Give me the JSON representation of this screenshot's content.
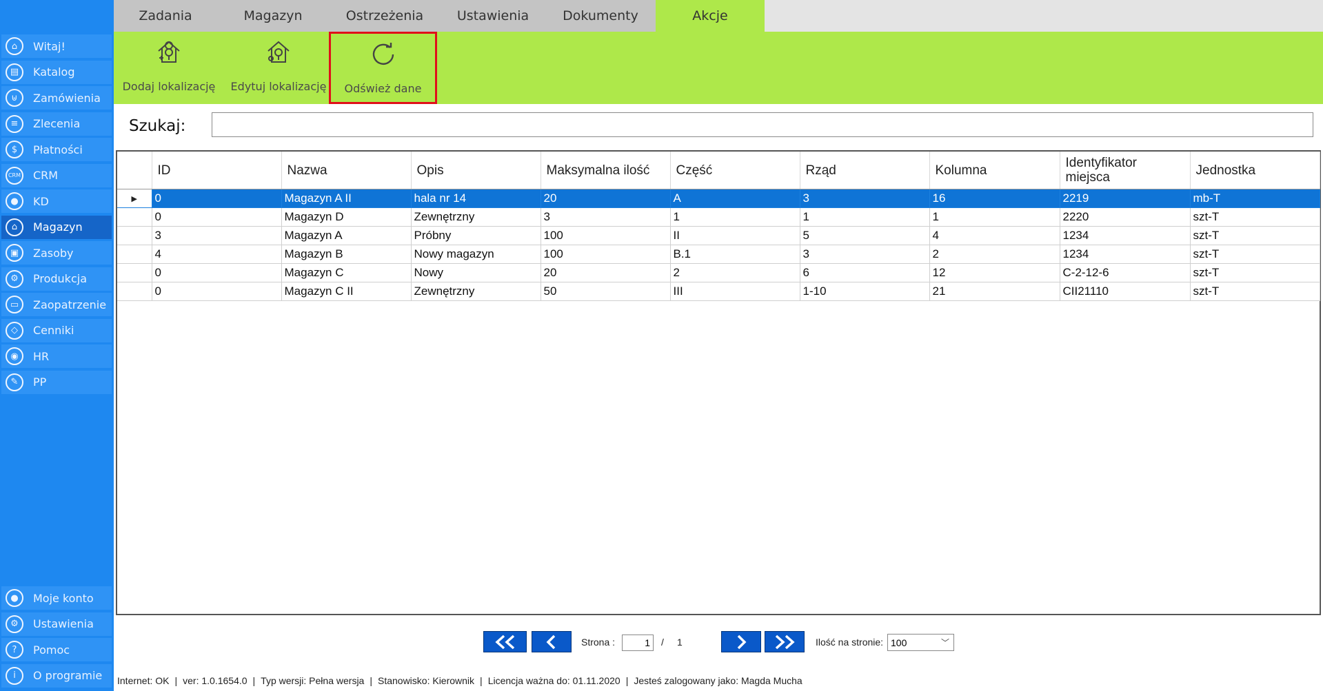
{
  "sidebar": {
    "top_items": [
      {
        "label": "Witaj!",
        "icon": "home-icon",
        "glyph": "⌂"
      },
      {
        "label": "Katalog",
        "icon": "book-icon",
        "glyph": "▤"
      },
      {
        "label": "Zamówienia",
        "icon": "cart-icon",
        "glyph": "⊎"
      },
      {
        "label": "Zlecenia",
        "icon": "list-icon",
        "glyph": "≡"
      },
      {
        "label": "Płatności",
        "icon": "dollar-icon",
        "glyph": "$"
      },
      {
        "label": "CRM",
        "icon": "crm-icon",
        "glyph": "CRM"
      },
      {
        "label": "KD",
        "icon": "person-icon",
        "glyph": "●"
      },
      {
        "label": "Magazyn",
        "icon": "warehouse-icon",
        "glyph": "⌂"
      },
      {
        "label": "Zasoby",
        "icon": "box-icon",
        "glyph": "▣"
      },
      {
        "label": "Produkcja",
        "icon": "production-icon",
        "glyph": "⚙"
      },
      {
        "label": "Zaopatrzenie",
        "icon": "truck-icon",
        "glyph": "▭"
      },
      {
        "label": "Cenniki",
        "icon": "tag-icon",
        "glyph": "◇"
      },
      {
        "label": "HR",
        "icon": "hr-icon",
        "glyph": "◉"
      },
      {
        "label": "PP",
        "icon": "pp-icon",
        "glyph": "✎"
      }
    ],
    "bottom_items": [
      {
        "label": "Moje konto",
        "icon": "account-icon",
        "glyph": "●"
      },
      {
        "label": "Ustawienia",
        "icon": "gear-icon",
        "glyph": "⚙"
      },
      {
        "label": "Pomoc",
        "icon": "help-icon",
        "glyph": "?"
      },
      {
        "label": "O programie",
        "icon": "info-icon",
        "glyph": "i"
      }
    ]
  },
  "tabs": [
    "Zadania",
    "Magazyn",
    "Ostrzeżenia",
    "Ustawienia",
    "Dokumenty",
    "Akcje"
  ],
  "toolbar": {
    "add_location": "Dodaj lokalizację",
    "edit_location": "Edytuj lokalizację",
    "refresh": "Odśwież dane"
  },
  "search": {
    "label": "Szukaj:",
    "value": ""
  },
  "table": {
    "columns": [
      "ID",
      "Nazwa",
      "Opis",
      "Maksymalna ilość",
      "Część",
      "Rząd",
      "Kolumna",
      "Identyfikator miejsca",
      "Jednostka"
    ],
    "rows": [
      [
        "0",
        "Magazyn A II",
        "hala nr 14",
        "20",
        "A",
        "3",
        "16",
        "2219",
        "mb-T"
      ],
      [
        "0",
        "Magazyn D",
        "Zewnętrzny",
        "3",
        "1",
        "1",
        "1",
        "2220",
        "szt-T"
      ],
      [
        "3",
        "Magazyn A",
        "Próbny",
        "100",
        "II",
        "5",
        "4",
        "1234",
        "szt-T"
      ],
      [
        "4",
        "Magazyn B",
        "Nowy magazyn",
        "100",
        "B.1",
        "3",
        "2",
        "1234",
        "szt-T"
      ],
      [
        "0",
        "Magazyn C",
        "Nowy",
        "20",
        "2",
        "6",
        "12",
        "C-2-12-6",
        "szt-T"
      ],
      [
        "0",
        "Magazyn C II",
        "Zewnętrzny",
        "50",
        "III",
        "1-10",
        "21",
        "CII21110",
        "szt-T"
      ]
    ]
  },
  "pager": {
    "page_label": "Strona :",
    "current_page": "1",
    "separator": "/",
    "total_pages": "1",
    "per_page_label": "Ilość na stronie:",
    "per_page_value": "100"
  },
  "status": {
    "internet": "Internet: OK",
    "version": "ver: 1.0.1654.0",
    "edition": "Typ wersji: Pełna wersja",
    "role": "Stanowisko: Kierownik",
    "license": "Licencja ważna do: 01.11.2020",
    "user": "Jesteś zalogowany jako: Magda Mucha"
  },
  "colors": {
    "sidebar": "#1e88f0",
    "sidebar_active": "#1565c8",
    "toolbar": "#aee84a",
    "selected_row": "#0f74d6",
    "highlight": "#e0101a"
  }
}
